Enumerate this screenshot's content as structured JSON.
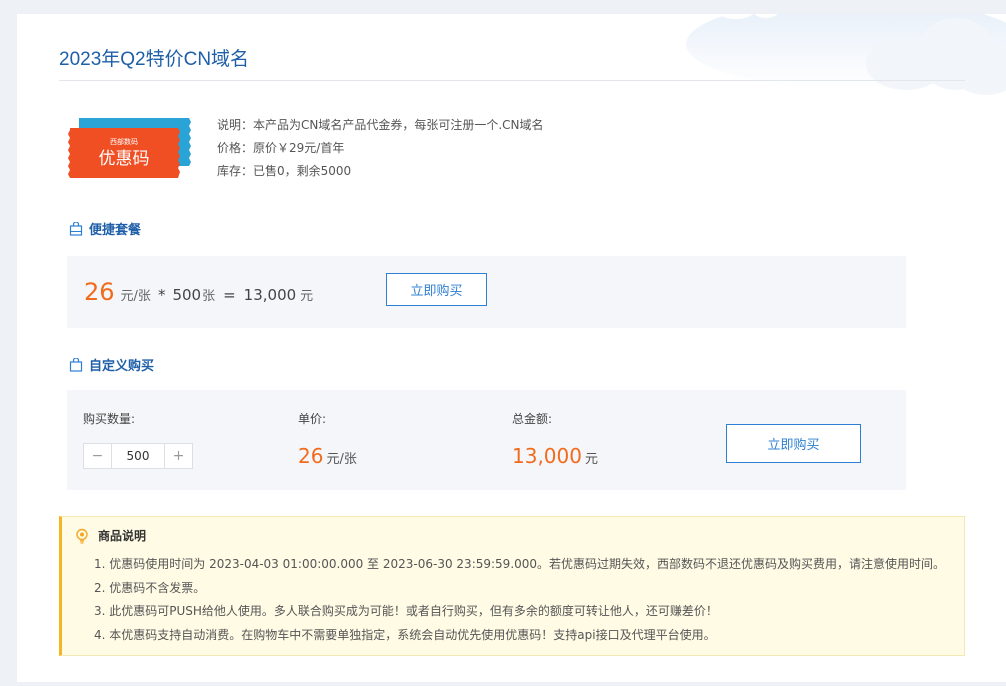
{
  "page": {
    "title": "2023年Q2特价CN域名"
  },
  "coupon": {
    "brand": "西部数码",
    "label": "优惠码"
  },
  "info": {
    "desc": "说明：本产品为CN域名产品代金券，每张可注册一个.CN域名",
    "price": "价格：原价￥29元/首年",
    "stock": "库存：已售0，剩余5000"
  },
  "quick": {
    "heading": "便捷套餐",
    "unit_price": "26",
    "unit_suffix": "元/张",
    "times": "*",
    "qty": "500",
    "qty_suffix": "张",
    "equals": "=",
    "total": "13,000",
    "total_suffix": "元",
    "buy_label": "立即购买"
  },
  "custom": {
    "heading": "自定义购买",
    "qty_label": "购买数量:",
    "minus": "−",
    "qty_value": "500",
    "plus": "+",
    "unit_label": "单价:",
    "unit_price": "26",
    "unit_suffix": "元/张",
    "total_label": "总金额:",
    "total": "13,000",
    "total_suffix": "元",
    "buy_label": "立即购买"
  },
  "notice": {
    "heading": "商品说明",
    "items": [
      "1. 优惠码使用时间为 2023-04-03 01:00:00.000 至 2023-06-30 23:59:59.000。若优惠码过期失效，西部数码不退还优惠码及购买费用，请注意使用时间。",
      "2. 优惠码不含发票。",
      "3. 此优惠码可PUSH给他人使用。多人联合购买成为可能！或者自行购买，但有多余的额度可转让他人，还可赚差价！",
      "4. 本优惠码支持自动消费。在购物车中不需要单独指定，系统会自动优先使用优惠码！支持api接口及代理平台使用。"
    ]
  },
  "colors": {
    "accent": "#1f5fa8",
    "price": "#f26b1d",
    "coupon_red": "#f04e23",
    "coupon_blue": "#2aa3d6"
  }
}
